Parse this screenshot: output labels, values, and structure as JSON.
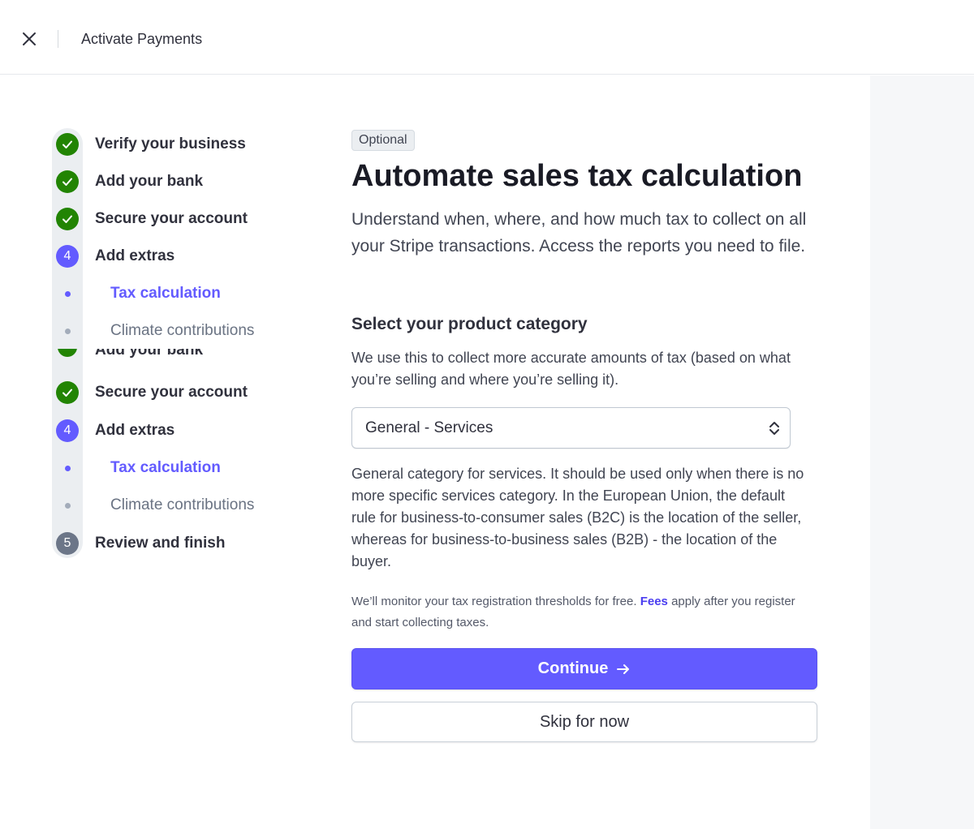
{
  "header": {
    "title": "Activate Payments",
    "close_icon": "close-icon"
  },
  "steps": [
    {
      "label": "Verify your business",
      "status": "done"
    },
    {
      "label": "Add your bank",
      "status": "done"
    },
    {
      "label": "Secure your account",
      "status": "done"
    },
    {
      "label": "Add extras",
      "status": "current",
      "number": "4"
    },
    {
      "label": "Tax calculation",
      "status": "substep-active"
    },
    {
      "label": "Climate contributions",
      "status": "substep"
    },
    {
      "label": "Add your bank",
      "status": "done-clipped"
    },
    {
      "label": "Secure your account",
      "status": "done"
    },
    {
      "label": "Add extras",
      "status": "current",
      "number": "4"
    },
    {
      "label": "Tax calculation",
      "status": "substep-active"
    },
    {
      "label": "Climate contributions",
      "status": "substep"
    },
    {
      "label": "Review and finish",
      "status": "future",
      "number": "5"
    }
  ],
  "main": {
    "badge": "Optional",
    "heading": "Automate sales tax calculation",
    "intro": "Understand when, where, and how much tax to collect on all your Stripe transactions. Access the reports you need to file.",
    "section_title": "Select your product category",
    "section_desc": "We use this to collect more accurate amounts of tax (based on what you’re selling and where you’re selling it).",
    "select_value": "General - Services",
    "category_desc": "General category for services. It should be used only when there is no more specific services category. In the European Union, the default rule for business-to-consumer sales (B2C) is the location of the seller, whereas for business-to-business sales (B2B) - the location of the buyer.",
    "monitor_note_before": "We’ll monitor your tax registration thresholds for free. ",
    "monitor_note_link": "Fees",
    "monitor_note_after": " apply after you register and start collecting taxes.",
    "continue_label": "Continue",
    "skip_label": "Skip for now"
  },
  "colors": {
    "accent": "#635bff",
    "done": "#228403",
    "future": "#6c7688",
    "link": "#4a3df0"
  }
}
